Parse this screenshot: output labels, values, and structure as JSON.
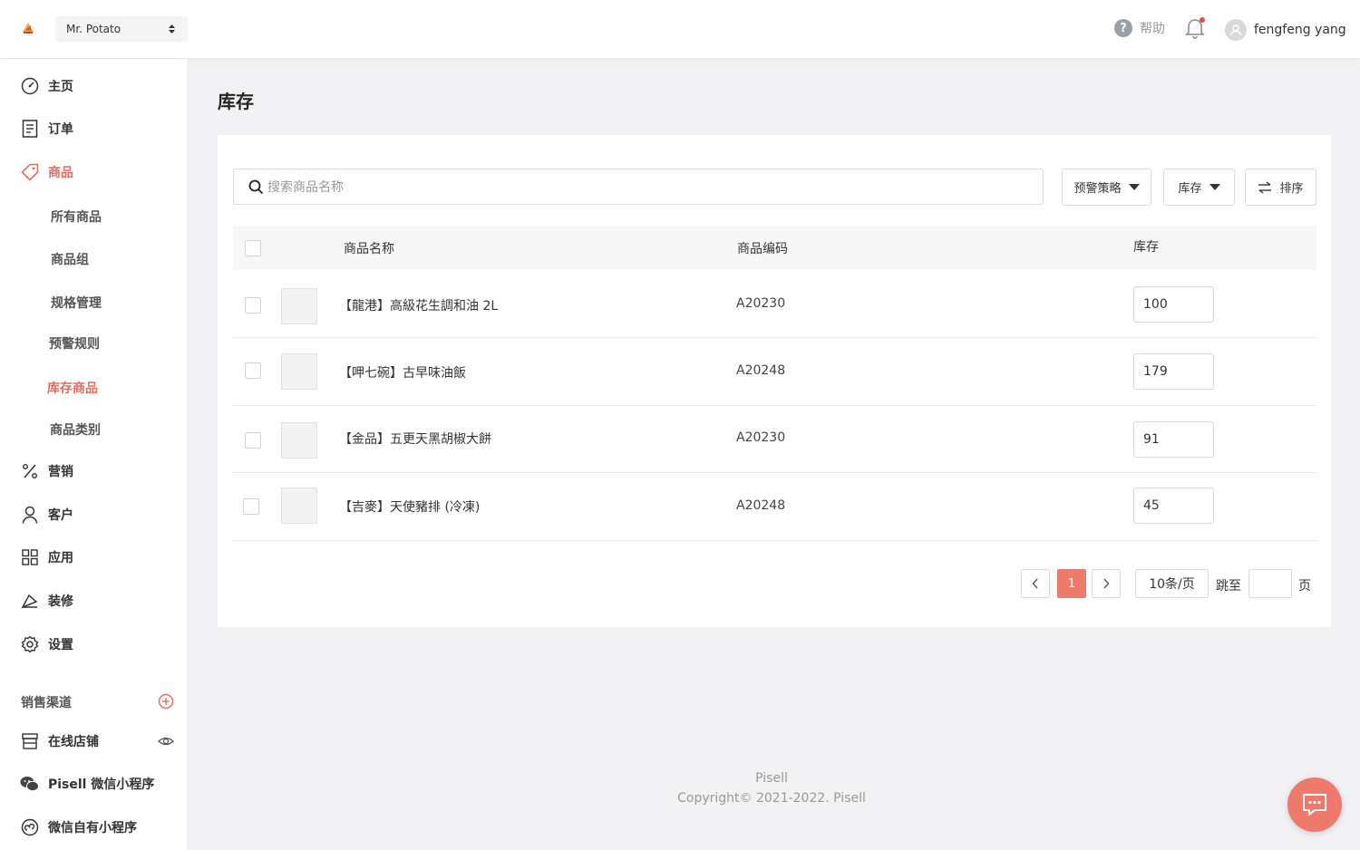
{
  "header": {
    "store_name": "Mr. Potato",
    "help_label": "帮助",
    "user_name": "fengfeng yang"
  },
  "sidebar": {
    "nav": [
      {
        "label": "主页",
        "icon": "dashboard-icon"
      },
      {
        "label": "订单",
        "icon": "order-icon"
      },
      {
        "label": "商品",
        "icon": "tag-icon",
        "active": true
      },
      {
        "label": "营销",
        "icon": "percent-icon"
      },
      {
        "label": "客户",
        "icon": "user-icon"
      },
      {
        "label": "应用",
        "icon": "apps-icon"
      },
      {
        "label": "装修",
        "icon": "brush-icon"
      },
      {
        "label": "设置",
        "icon": "gear-icon"
      }
    ],
    "sub_items": [
      "所有商品",
      "商品组",
      "规格管理",
      "预警规则",
      "库存商品",
      "商品类别"
    ],
    "active_sub": "库存商品",
    "channels_title": "销售渠道",
    "channels": [
      {
        "label": "在线店铺",
        "icon": "store-icon"
      },
      {
        "label": "Pisell 微信小程序",
        "icon": "wechat-icon"
      },
      {
        "label": "微信自有小程序",
        "icon": "miniprogram-icon"
      }
    ]
  },
  "main": {
    "title": "库存",
    "search_placeholder": "搜索商品名称",
    "filter_warning": "预警策略",
    "filter_stock": "库存",
    "sort_label": "排序",
    "columns": [
      "商品名称",
      "商品编码",
      "库存"
    ],
    "rows": [
      {
        "name": "【龍港】高級花生調和油 2L",
        "code": "A20230",
        "stock": "100"
      },
      {
        "name": "【呷七碗】古早味油飯",
        "code": "A20248",
        "stock": "179"
      },
      {
        "name": "【金品】五更天黑胡椒大餅",
        "code": "A20230",
        "stock": "91"
      },
      {
        "name": "【吉麥】天使豬排 (冷凍)",
        "code": "A20248",
        "stock": "45"
      }
    ],
    "pagination": {
      "current": "1",
      "page_size": "10条/页",
      "jump_label": "跳至",
      "page_label": "页"
    }
  },
  "footer": {
    "brand": "Pisell",
    "copyright": "Copyright© 2021-2022. Pisell"
  },
  "colors": {
    "accent": "#ee7a6c",
    "active_text": "#e86a5e"
  }
}
